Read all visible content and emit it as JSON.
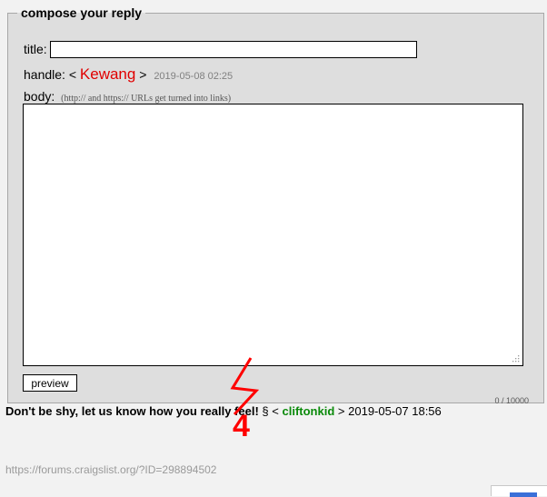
{
  "compose": {
    "legend": "compose your reply",
    "title_label": "title:",
    "title_value": "",
    "handle_label": "handle:",
    "handle_open": "<",
    "handle_name": "Kewang",
    "handle_close": ">",
    "handle_timestamp": "2019-05-08 02:25",
    "body_label": "body:",
    "body_hint": "(http:// and https:// URLs get turned into links)",
    "body_value": "",
    "preview_label": "preview",
    "char_counter": "0 / 10000"
  },
  "post": {
    "title": "Don't be shy, let us know how you really feel!",
    "section_mark": "§",
    "open": "<",
    "author": "cliftonkid",
    "close": ">",
    "timestamp": "2019-05-07 18:56"
  },
  "footer": {
    "url": "https://forums.craigslist.org/?ID=298894502"
  },
  "annotation": {
    "number": "4",
    "color": "#ff0000"
  },
  "icons": {
    "resize_grip": "resize-grip-icon"
  }
}
